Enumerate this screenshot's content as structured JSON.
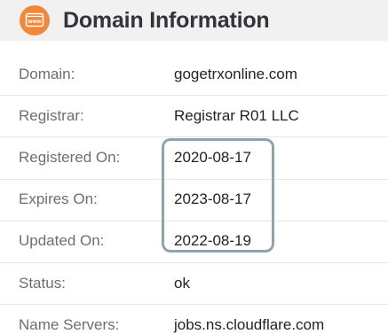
{
  "header": {
    "title": "Domain Information",
    "icon": "www-icon",
    "icon_text": "www",
    "icon_color": "#f0883a"
  },
  "rows": [
    {
      "label": "Domain:",
      "value": "gogetrxonline.com"
    },
    {
      "label": "Registrar:",
      "value": "Registrar R01 LLC"
    },
    {
      "label": "Registered On:",
      "value": "2020-08-17"
    },
    {
      "label": "Expires On:",
      "value": "2023-08-17"
    },
    {
      "label": "Updated On:",
      "value": "2022-08-19"
    },
    {
      "label": "Status:",
      "value": "ok"
    },
    {
      "label": "Name Servers:",
      "value": "jobs.ns.cloudflare.com"
    }
  ],
  "colors": {
    "header_bg": "#f1f1f1",
    "highlight_border": "#8fa4ad",
    "label_text": "#6b6f74",
    "value_text": "#232323",
    "divider": "#e7e7e7"
  }
}
